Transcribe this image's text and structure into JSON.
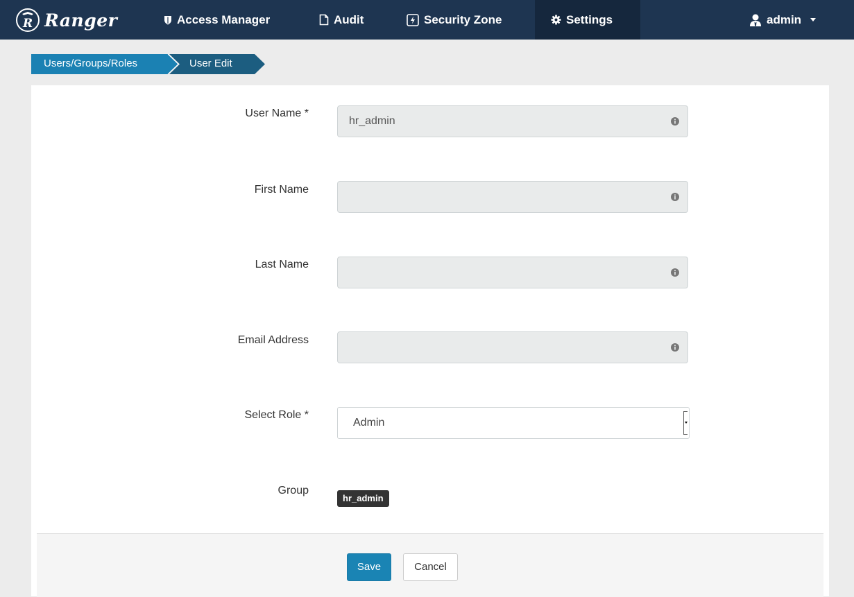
{
  "app": {
    "brand": "Ranger"
  },
  "nav": {
    "access_manager": "Access Manager",
    "audit": "Audit",
    "security_zone": "Security Zone",
    "settings": "Settings",
    "user": "admin"
  },
  "breadcrumb": {
    "items": [
      "Users/Groups/Roles",
      "User Edit"
    ]
  },
  "form": {
    "user_name": {
      "label": "User Name *",
      "value": "hr_admin"
    },
    "first_name": {
      "label": "First Name",
      "value": ""
    },
    "last_name": {
      "label": "Last Name",
      "value": ""
    },
    "email": {
      "label": "Email Address",
      "value": ""
    },
    "role": {
      "label": "Select Role *",
      "value": "Admin"
    },
    "group": {
      "label": "Group",
      "tags": [
        "hr_admin"
      ]
    }
  },
  "actions": {
    "save": "Save",
    "cancel": "Cancel"
  },
  "colors": {
    "navbar": "#1e3551",
    "navbar_active": "#15273d",
    "breadcrumb_first": "#1b81b3",
    "breadcrumb_second": "#1c5d80",
    "save_button": "#1a84b4",
    "group_tag": "#333333"
  }
}
